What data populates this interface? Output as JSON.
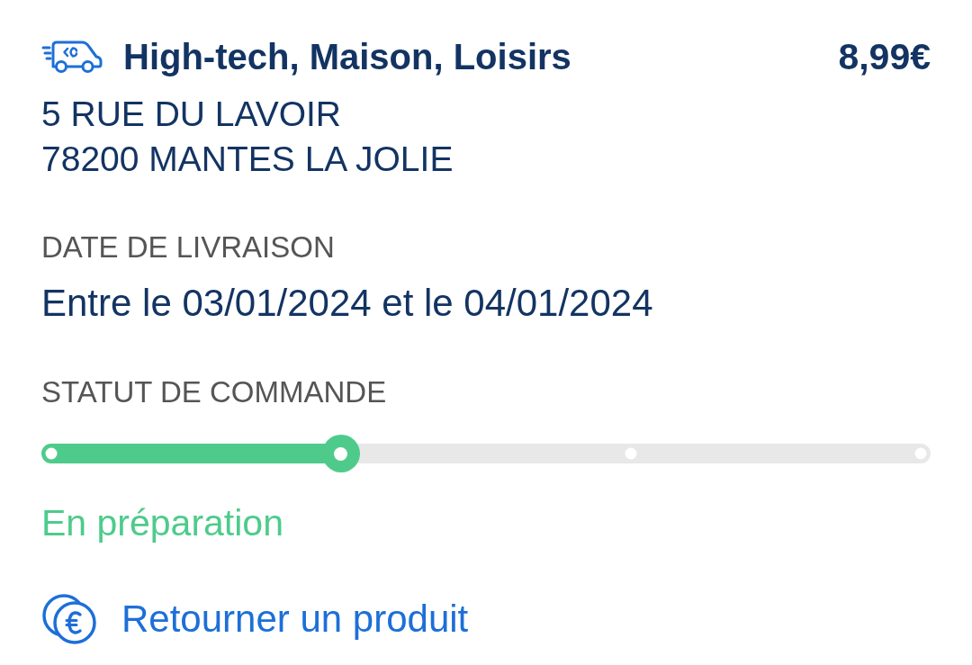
{
  "delivery": {
    "category": "High-tech, Maison, Loisirs",
    "price": "8,99€",
    "address_lines": [
      "5 RUE DU LAVOIR",
      "78200 MANTES LA JOLIE"
    ]
  },
  "delivery_date": {
    "label": "DATE DE LIVRAISON",
    "value": "Entre le 03/01/2024 et le 04/01/2024"
  },
  "order_status": {
    "label": "STATUT DE COMMANDE",
    "level": 0.33,
    "steps": [
      {
        "selected": false
      },
      {
        "selected": true
      },
      {
        "selected": false
      },
      {
        "selected": false
      }
    ],
    "status": "En préparation"
  },
  "return_link": {
    "label": "Retourner un produit"
  }
}
